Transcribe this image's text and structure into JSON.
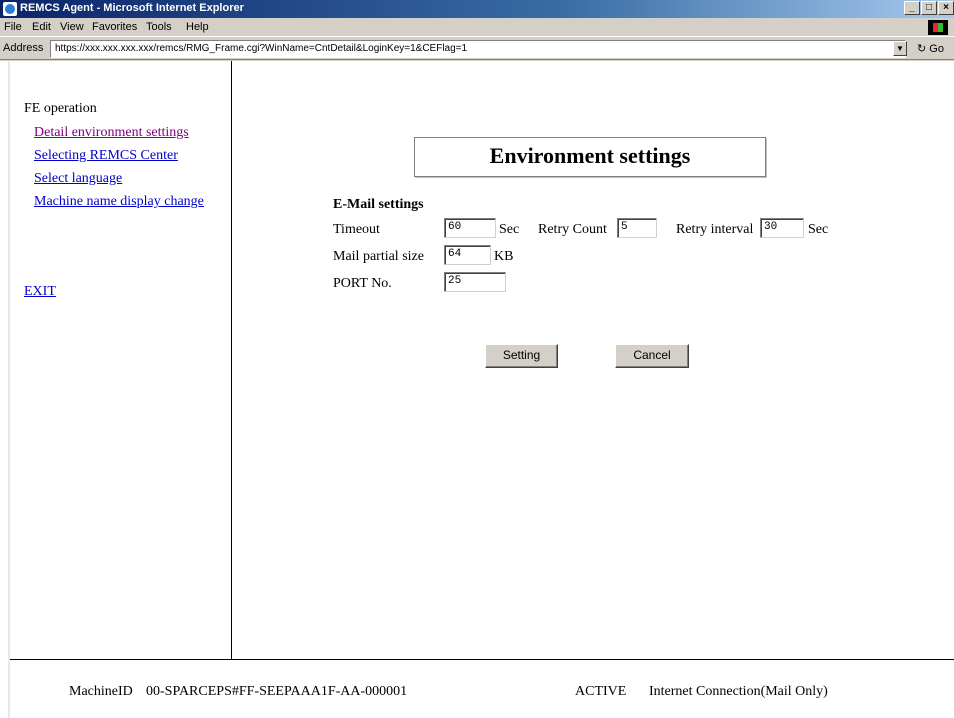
{
  "window": {
    "title": "REMCS Agent - Microsoft Internet Explorer",
    "controls": {
      "minimize": "_",
      "maximize": "□",
      "close": "×"
    }
  },
  "menu": [
    "File",
    "Edit",
    "View",
    "Favorites",
    "Tools",
    "Help"
  ],
  "address": {
    "label": "Address",
    "url": "https://xxx.xxx.xxx.xxx/remcs/RMG_Frame.cgi?WinName=CntDetail&LoginKey=1&CEFlag=1",
    "go_label": "Go"
  },
  "nav": {
    "heading": "FE operation",
    "links": [
      "Detail environment settings",
      "Selecting REMCS Center",
      "Select language",
      "Machine name display change"
    ],
    "exit": "EXIT"
  },
  "main": {
    "title": "Environment settings",
    "section": "E-Mail settings",
    "timeout": {
      "label": "Timeout",
      "value": "60",
      "unit": "Sec"
    },
    "retry_count": {
      "label": "Retry Count",
      "value": "5"
    },
    "retry_interval": {
      "label": "Retry interval",
      "value": "30",
      "unit": "Sec"
    },
    "mail_partial_size": {
      "label": "Mail partial size",
      "value": "64",
      "unit": "KB"
    },
    "port": {
      "label": "PORT No.",
      "value": "25"
    },
    "setting_button": "Setting",
    "cancel_button": "Cancel"
  },
  "status": {
    "machine_label": "MachineID",
    "machine_id": "00-SPARCEPS#FF-SEEPAAA1F-AA-000001",
    "state": "ACTIVE",
    "connection": "Internet Connection(Mail Only)"
  }
}
